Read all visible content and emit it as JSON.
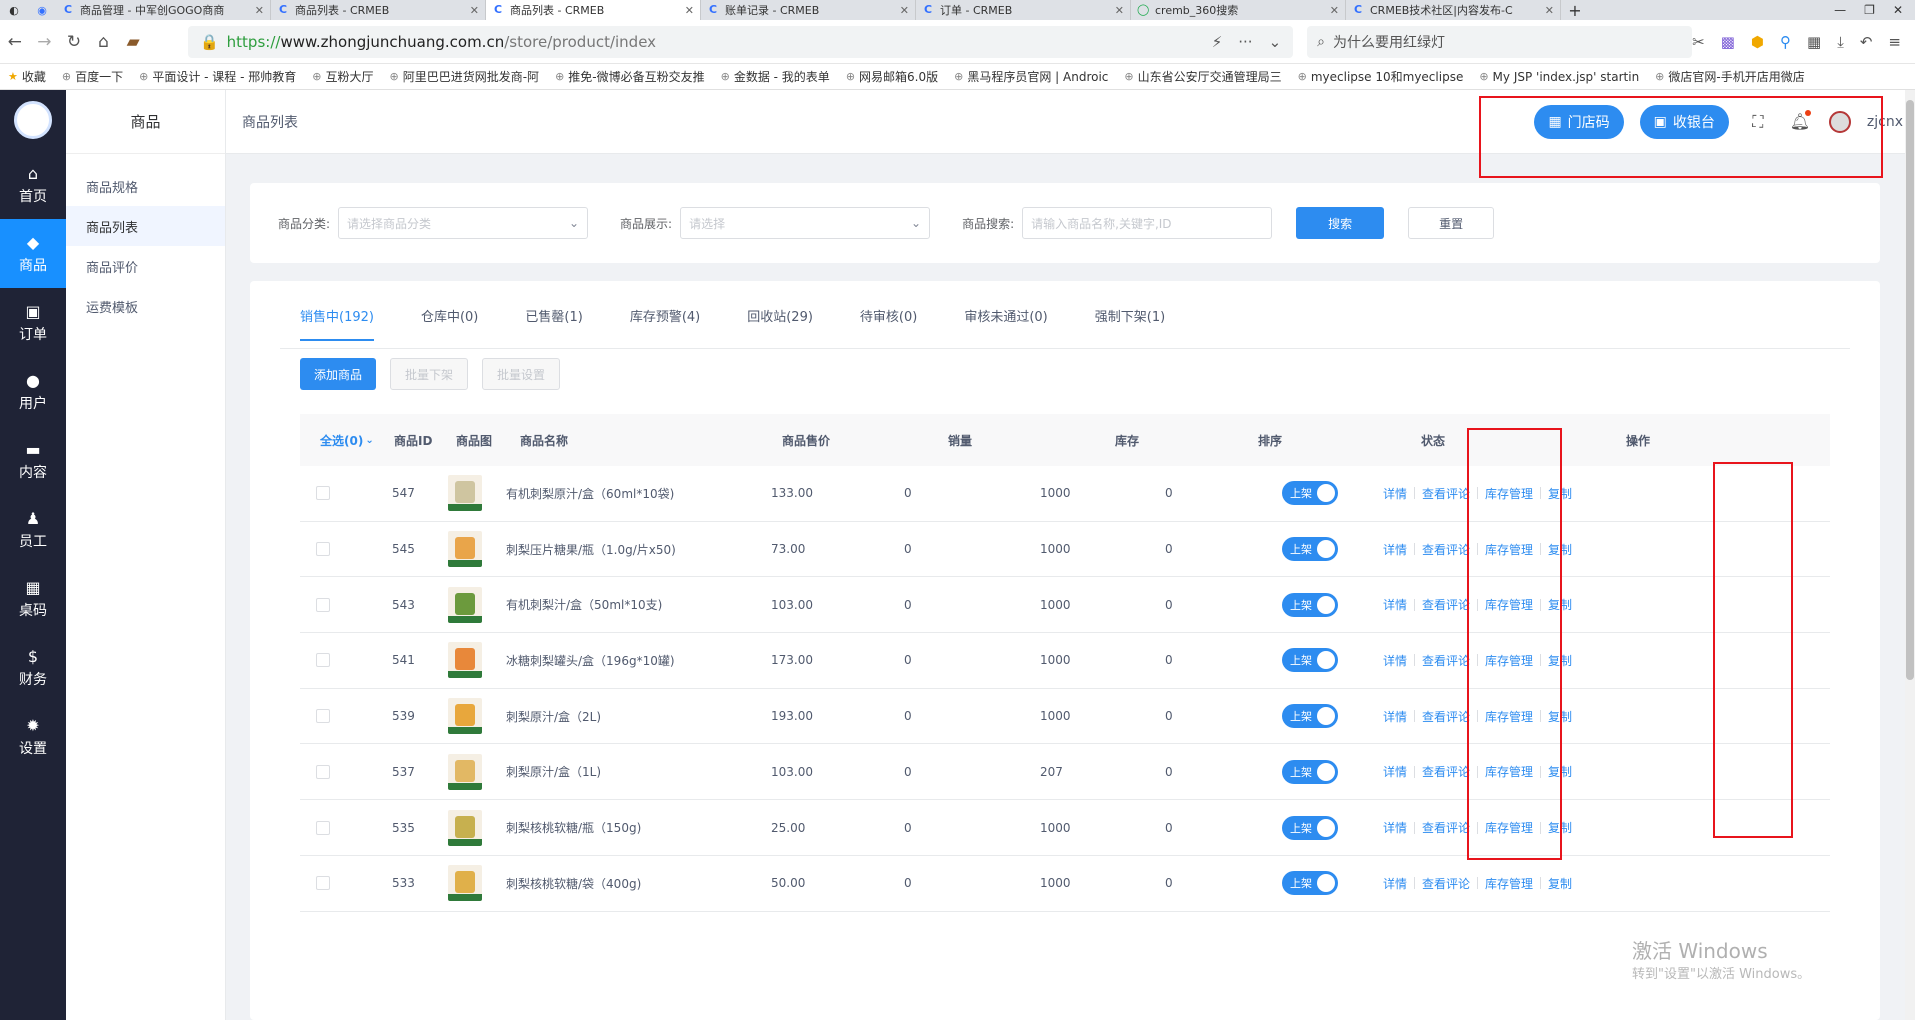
{
  "browser": {
    "tabs": [
      {
        "title": "商品管理 - 中军创GOGO商商",
        "active": false
      },
      {
        "title": "商品列表 - CRMEB",
        "active": false
      },
      {
        "title": "商品列表 - CRMEB",
        "active": true
      },
      {
        "title": "账单记录 - CRMEB",
        "active": false
      },
      {
        "title": "订单 - CRMEB",
        "active": false
      },
      {
        "title": "cremb_360搜索",
        "active": false
      },
      {
        "title": "CRMEB技术社区|内容发布-C",
        "active": false
      }
    ],
    "new_tab": "+",
    "url_protocol": "https://",
    "url_host": "www.zhongjunchuang.com.cn",
    "url_path": "/store/product/index",
    "search_text": "为什么要用红绿灯",
    "bookmarks": [
      "收藏",
      "百度一下",
      "平面设计 - 课程 - 邢帅教育",
      "互粉大厅",
      "阿里巴巴进货网批发商-阿",
      "推免-微博必备互粉交友推",
      "金数据 - 我的表单",
      "网易邮箱6.0版",
      "黑马程序员官网 | Androic",
      "山东省公安厅交通管理局三",
      "myeclipse 10和myeclipse",
      "My JSP 'index.jsp' startin",
      "微店官网-手机开店用微店"
    ]
  },
  "leftnav": [
    {
      "label": "首页",
      "icon": "home-icon",
      "glyph": "⌂",
      "active": false
    },
    {
      "label": "商品",
      "icon": "bag-icon",
      "glyph": "◆",
      "active": true
    },
    {
      "label": "订单",
      "icon": "cart-icon",
      "glyph": "▣",
      "active": false
    },
    {
      "label": "用户",
      "icon": "users-icon",
      "glyph": "●",
      "active": false
    },
    {
      "label": "内容",
      "icon": "folder-icon",
      "glyph": "▬",
      "active": false
    },
    {
      "label": "员工",
      "icon": "person-icon",
      "glyph": "♟",
      "active": false
    },
    {
      "label": "桌码",
      "icon": "qrcode-icon",
      "glyph": "▦",
      "active": false
    },
    {
      "label": "财务",
      "icon": "dollar-icon",
      "glyph": "$",
      "active": false
    },
    {
      "label": "设置",
      "icon": "gear-icon",
      "glyph": "✹",
      "active": false
    }
  ],
  "submenu": {
    "title": "商品",
    "items": [
      {
        "label": "商品规格",
        "active": false
      },
      {
        "label": "商品列表",
        "active": true
      },
      {
        "label": "商品评价",
        "active": false
      },
      {
        "label": "运费模板",
        "active": false
      }
    ]
  },
  "header": {
    "breadcrumb": "商品列表",
    "store_code_label": "门店码",
    "cashier_label": "收银台",
    "username": "zjcnx"
  },
  "filter": {
    "category_label": "商品分类:",
    "category_placeholder": "请选择商品分类",
    "display_label": "商品展示:",
    "display_placeholder": "请选择",
    "search_label": "商品搜索:",
    "search_placeholder": "请输入商品名称,关键字,ID",
    "search_button": "搜索",
    "reset_button": "重置"
  },
  "tabs": [
    {
      "label": "销售中(192)",
      "active": true
    },
    {
      "label": "仓库中(0)",
      "active": false
    },
    {
      "label": "已售罄(1)",
      "active": false
    },
    {
      "label": "库存预警(4)",
      "active": false
    },
    {
      "label": "回收站(29)",
      "active": false
    },
    {
      "label": "待审核(0)",
      "active": false
    },
    {
      "label": "审核未通过(0)",
      "active": false
    },
    {
      "label": "强制下架(1)",
      "active": false
    }
  ],
  "actions": {
    "add": "添加商品",
    "bulk_off": "批量下架",
    "bulk_set": "批量设置"
  },
  "table": {
    "headers": {
      "select_all": "全选(0)",
      "id": "商品ID",
      "image": "商品图",
      "name": "商品名称",
      "price": "商品售价",
      "sales": "销量",
      "stock": "库存",
      "sort": "排序",
      "status": "状态",
      "ops": "操作"
    },
    "status_on": "上架",
    "ops": {
      "detail": "详情",
      "reviews": "查看评论",
      "stock": "库存管理",
      "copy": "复制"
    },
    "rows": [
      {
        "id": "547",
        "name": "有机刺梨原汁/盒（60ml*10袋)",
        "price": "133.00",
        "sales": "0",
        "stock": "1000",
        "sort": "0",
        "thumb_color": "#cfc5a0"
      },
      {
        "id": "545",
        "name": "刺梨压片糖果/瓶（1.0g/片x50)",
        "price": "73.00",
        "sales": "0",
        "stock": "1000",
        "sort": "0",
        "thumb_color": "#e9a54a"
      },
      {
        "id": "543",
        "name": "有机刺梨汁/盒（50ml*10支)",
        "price": "103.00",
        "sales": "0",
        "stock": "1000",
        "sort": "0",
        "thumb_color": "#6c9a3d"
      },
      {
        "id": "541",
        "name": "冰糖刺梨罐头/盒（196g*10罐)",
        "price": "173.00",
        "sales": "0",
        "stock": "1000",
        "sort": "0",
        "thumb_color": "#e8883a"
      },
      {
        "id": "539",
        "name": "刺梨原汁/盒（2L)",
        "price": "193.00",
        "sales": "0",
        "stock": "1000",
        "sort": "0",
        "thumb_color": "#e8a73c"
      },
      {
        "id": "537",
        "name": "刺梨原汁/盒（1L)",
        "price": "103.00",
        "sales": "0",
        "stock": "207",
        "sort": "0",
        "thumb_color": "#e2b864"
      },
      {
        "id": "535",
        "name": "刺梨核桃软糖/瓶（150g)",
        "price": "25.00",
        "sales": "0",
        "stock": "1000",
        "sort": "0",
        "thumb_color": "#c7b04f"
      },
      {
        "id": "533",
        "name": "刺梨核桃软糖/袋（400g)",
        "price": "50.00",
        "sales": "0",
        "stock": "1000",
        "sort": "0",
        "thumb_color": "#e0b04a"
      }
    ]
  },
  "watermark": {
    "line1": "激活 Windows",
    "line2": "转到\"设置\"以激活 Windows。"
  }
}
